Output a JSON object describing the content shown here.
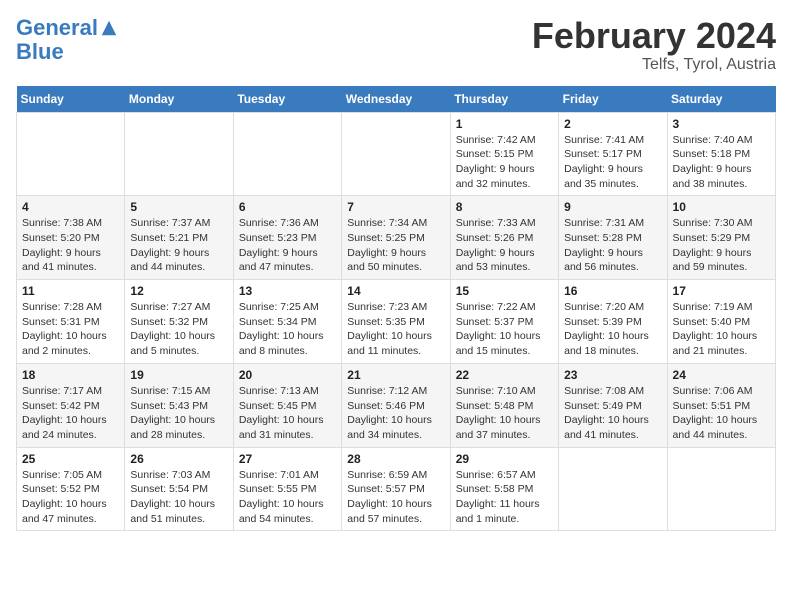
{
  "header": {
    "logo_line1": "General",
    "logo_line2": "Blue",
    "title": "February 2024",
    "location": "Telfs, Tyrol, Austria"
  },
  "columns": [
    "Sunday",
    "Monday",
    "Tuesday",
    "Wednesday",
    "Thursday",
    "Friday",
    "Saturday"
  ],
  "weeks": [
    [
      {
        "day": "",
        "detail": ""
      },
      {
        "day": "",
        "detail": ""
      },
      {
        "day": "",
        "detail": ""
      },
      {
        "day": "",
        "detail": ""
      },
      {
        "day": "1",
        "detail": "Sunrise: 7:42 AM\nSunset: 5:15 PM\nDaylight: 9 hours\nand 32 minutes."
      },
      {
        "day": "2",
        "detail": "Sunrise: 7:41 AM\nSunset: 5:17 PM\nDaylight: 9 hours\nand 35 minutes."
      },
      {
        "day": "3",
        "detail": "Sunrise: 7:40 AM\nSunset: 5:18 PM\nDaylight: 9 hours\nand 38 minutes."
      }
    ],
    [
      {
        "day": "4",
        "detail": "Sunrise: 7:38 AM\nSunset: 5:20 PM\nDaylight: 9 hours\nand 41 minutes."
      },
      {
        "day": "5",
        "detail": "Sunrise: 7:37 AM\nSunset: 5:21 PM\nDaylight: 9 hours\nand 44 minutes."
      },
      {
        "day": "6",
        "detail": "Sunrise: 7:36 AM\nSunset: 5:23 PM\nDaylight: 9 hours\nand 47 minutes."
      },
      {
        "day": "7",
        "detail": "Sunrise: 7:34 AM\nSunset: 5:25 PM\nDaylight: 9 hours\nand 50 minutes."
      },
      {
        "day": "8",
        "detail": "Sunrise: 7:33 AM\nSunset: 5:26 PM\nDaylight: 9 hours\nand 53 minutes."
      },
      {
        "day": "9",
        "detail": "Sunrise: 7:31 AM\nSunset: 5:28 PM\nDaylight: 9 hours\nand 56 minutes."
      },
      {
        "day": "10",
        "detail": "Sunrise: 7:30 AM\nSunset: 5:29 PM\nDaylight: 9 hours\nand 59 minutes."
      }
    ],
    [
      {
        "day": "11",
        "detail": "Sunrise: 7:28 AM\nSunset: 5:31 PM\nDaylight: 10 hours\nand 2 minutes."
      },
      {
        "day": "12",
        "detail": "Sunrise: 7:27 AM\nSunset: 5:32 PM\nDaylight: 10 hours\nand 5 minutes."
      },
      {
        "day": "13",
        "detail": "Sunrise: 7:25 AM\nSunset: 5:34 PM\nDaylight: 10 hours\nand 8 minutes."
      },
      {
        "day": "14",
        "detail": "Sunrise: 7:23 AM\nSunset: 5:35 PM\nDaylight: 10 hours\nand 11 minutes."
      },
      {
        "day": "15",
        "detail": "Sunrise: 7:22 AM\nSunset: 5:37 PM\nDaylight: 10 hours\nand 15 minutes."
      },
      {
        "day": "16",
        "detail": "Sunrise: 7:20 AM\nSunset: 5:39 PM\nDaylight: 10 hours\nand 18 minutes."
      },
      {
        "day": "17",
        "detail": "Sunrise: 7:19 AM\nSunset: 5:40 PM\nDaylight: 10 hours\nand 21 minutes."
      }
    ],
    [
      {
        "day": "18",
        "detail": "Sunrise: 7:17 AM\nSunset: 5:42 PM\nDaylight: 10 hours\nand 24 minutes."
      },
      {
        "day": "19",
        "detail": "Sunrise: 7:15 AM\nSunset: 5:43 PM\nDaylight: 10 hours\nand 28 minutes."
      },
      {
        "day": "20",
        "detail": "Sunrise: 7:13 AM\nSunset: 5:45 PM\nDaylight: 10 hours\nand 31 minutes."
      },
      {
        "day": "21",
        "detail": "Sunrise: 7:12 AM\nSunset: 5:46 PM\nDaylight: 10 hours\nand 34 minutes."
      },
      {
        "day": "22",
        "detail": "Sunrise: 7:10 AM\nSunset: 5:48 PM\nDaylight: 10 hours\nand 37 minutes."
      },
      {
        "day": "23",
        "detail": "Sunrise: 7:08 AM\nSunset: 5:49 PM\nDaylight: 10 hours\nand 41 minutes."
      },
      {
        "day": "24",
        "detail": "Sunrise: 7:06 AM\nSunset: 5:51 PM\nDaylight: 10 hours\nand 44 minutes."
      }
    ],
    [
      {
        "day": "25",
        "detail": "Sunrise: 7:05 AM\nSunset: 5:52 PM\nDaylight: 10 hours\nand 47 minutes."
      },
      {
        "day": "26",
        "detail": "Sunrise: 7:03 AM\nSunset: 5:54 PM\nDaylight: 10 hours\nand 51 minutes."
      },
      {
        "day": "27",
        "detail": "Sunrise: 7:01 AM\nSunset: 5:55 PM\nDaylight: 10 hours\nand 54 minutes."
      },
      {
        "day": "28",
        "detail": "Sunrise: 6:59 AM\nSunset: 5:57 PM\nDaylight: 10 hours\nand 57 minutes."
      },
      {
        "day": "29",
        "detail": "Sunrise: 6:57 AM\nSunset: 5:58 PM\nDaylight: 11 hours\nand 1 minute."
      },
      {
        "day": "",
        "detail": ""
      },
      {
        "day": "",
        "detail": ""
      }
    ]
  ]
}
